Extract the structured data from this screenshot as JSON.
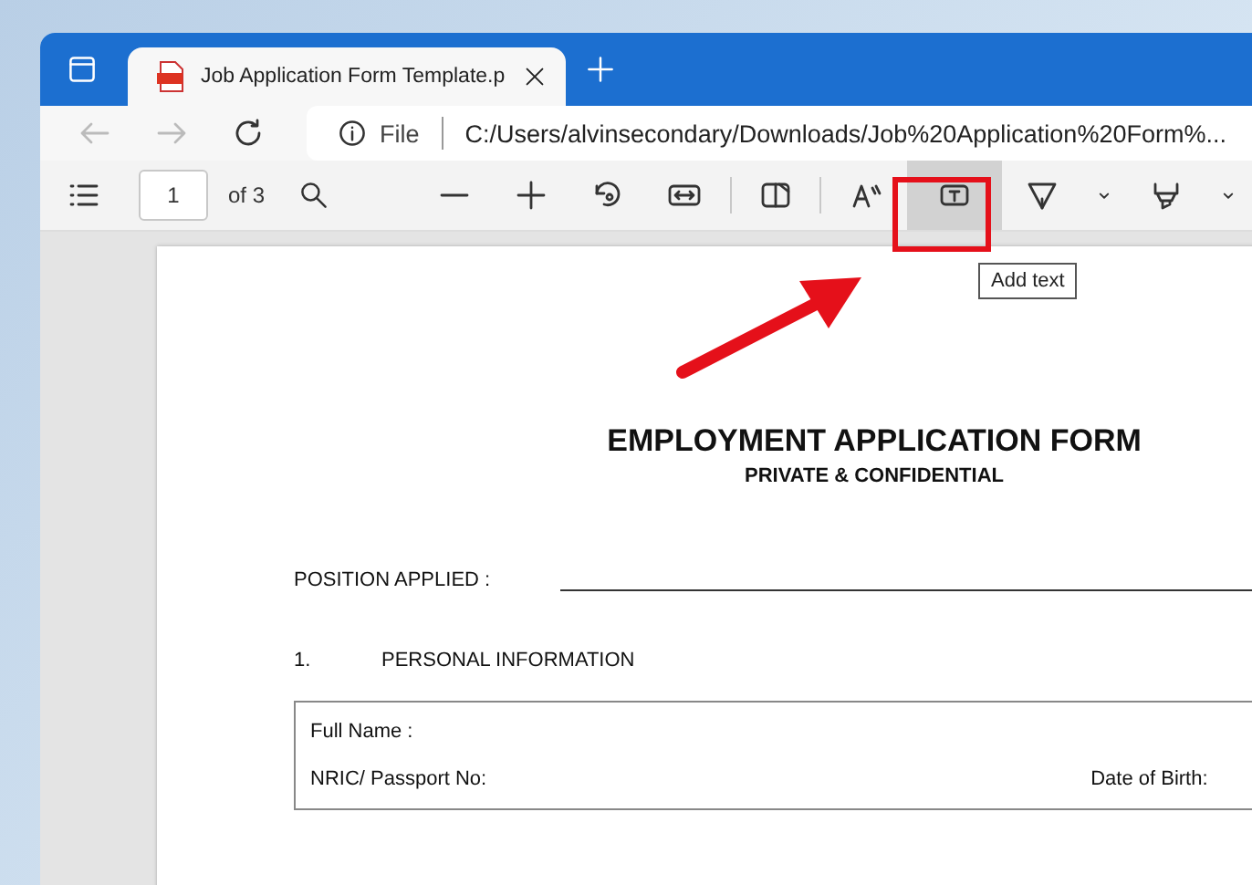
{
  "browser": {
    "tab": {
      "title": "Job Application Form Template.p",
      "selected": true
    },
    "address": {
      "scheme": "File",
      "url": "C:/Users/alvinsecondary/Downloads/Job%20Application%20Form%..."
    }
  },
  "pdf_toolbar": {
    "page": "1",
    "page_count": "of 3",
    "tools": [
      {
        "kind": "zoom-out",
        "hovered": false
      },
      {
        "kind": "zoom-in",
        "hovered": false
      },
      {
        "kind": "rotate",
        "hovered": false
      },
      {
        "kind": "fit",
        "hovered": false
      },
      {
        "kind": "separator"
      },
      {
        "kind": "page-view",
        "hovered": false
      },
      {
        "kind": "separator"
      },
      {
        "kind": "read-aloud",
        "hovered": false
      },
      {
        "kind": "add-text",
        "hovered": true
      },
      {
        "kind": "draw",
        "hovered": false
      },
      {
        "kind": "chevron",
        "hovered": false
      },
      {
        "kind": "highlight",
        "hovered": false
      },
      {
        "kind": "chevron",
        "hovered": false
      }
    ],
    "tooltip": "Add text"
  },
  "document": {
    "title": "EMPLOYMENT APPLICATION FORM",
    "subtitle": "PRIVATE & CONFIDENTIAL",
    "position_label": "POSITION APPLIED :",
    "section": {
      "number": "1.",
      "title": "PERSONAL INFORMATION"
    },
    "fields": [
      {
        "label": "Full Name :"
      },
      {
        "label": "NRIC/ Passport No:",
        "extra": "Date of Birth:"
      }
    ]
  }
}
